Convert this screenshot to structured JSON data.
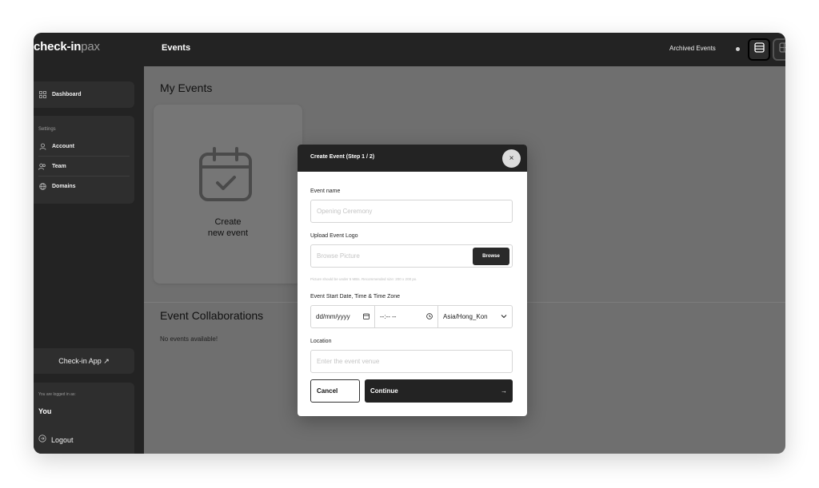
{
  "brand": {
    "part1": "check-in",
    "part2": "pax"
  },
  "sidebar": {
    "dashboard_label": "Dashboard",
    "settings_heading": "Settings",
    "items": [
      {
        "label": "Account",
        "icon": "user-icon"
      },
      {
        "label": "Team",
        "icon": "team-icon"
      },
      {
        "label": "Domains",
        "icon": "globe-icon"
      }
    ],
    "checkin_app_label": "Check-in App ↗",
    "logged_in_label": "You are logged in as:",
    "user_name": "You",
    "logout_label": "Logout"
  },
  "topbar": {
    "title": "Events",
    "archived_label": "Archived Events"
  },
  "main": {
    "my_events_heading": "My Events",
    "create_line1": "Create",
    "create_line2": "new event",
    "collab_heading": "Event Collaborations",
    "no_events": "No events available!"
  },
  "modal": {
    "title": "Create Event (Step 1 / 2)",
    "close_glyph": "×",
    "event_name_label": "Event name",
    "event_name_placeholder": "Opening Ceremony",
    "logo_label": "Upload Event Logo",
    "logo_placeholder": "Browse Picture",
    "browse_label": "Browse",
    "logo_hint": "Picture should be under 5 MBs. Recommended size: 200 x 200 px.",
    "datetime_label": "Event Start Date, Time & Time Zone",
    "date_value": "dd/mm/yyyy",
    "time_value": "--:-- --",
    "timezone_value": "Asia/Hong_Kon",
    "location_label": "Location",
    "location_placeholder": "Enter the event venue",
    "cancel_label": "Cancel",
    "continue_label": "Continue",
    "continue_arrow": "→"
  }
}
